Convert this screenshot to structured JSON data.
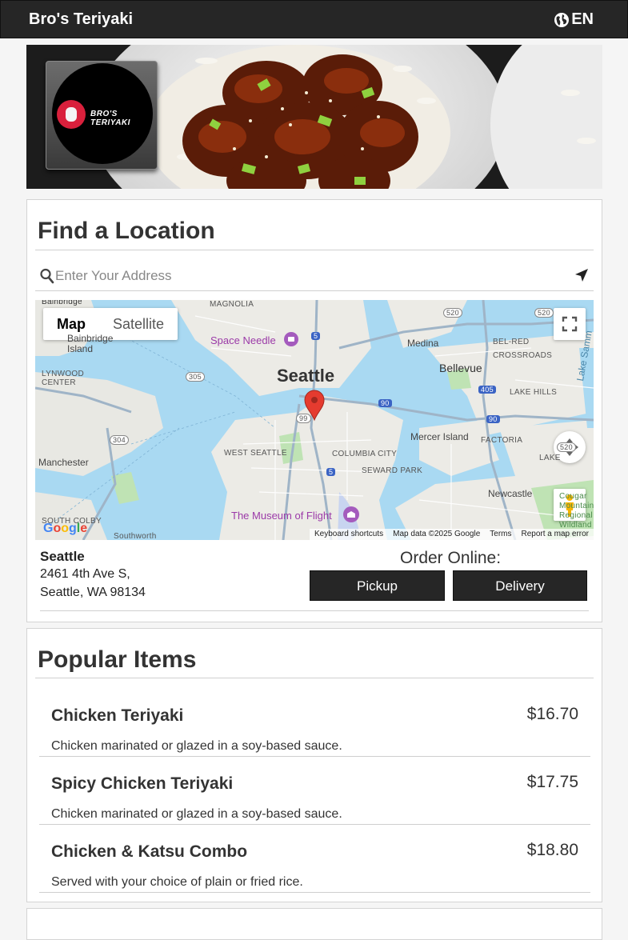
{
  "header": {
    "brand": "Bro's Teriyaki",
    "language": "EN",
    "globe_icon": "globe-icon"
  },
  "hero": {
    "logo_text": "BRO'S TERIYAKI"
  },
  "location": {
    "title": "Find a Location",
    "search_placeholder": "Enter Your Address",
    "map": {
      "toggle_map": "Map",
      "toggle_satellite": "Satellite",
      "labels": {
        "bainbridge": "Bainbridge",
        "bainbridge_island": "Bainbridge\nIsland",
        "magnolia": "MAGNOLIA",
        "space_needle": "Space Needle",
        "seattle": "Seattle",
        "medina": "Medina",
        "bellevue": "Bellevue",
        "bel_red": "BEL-RED",
        "crossroads": "CROSSROADS",
        "lake_hills": "LAKE HILLS",
        "lynwood_center": "LYNWOOD\nCENTER",
        "mercer_island": "Mercer Island",
        "factoria": "FACTORIA",
        "manchester": "Manchester",
        "west_seattle": "WEST SEATTLE",
        "columbia_city": "COLUMBIA CITY",
        "seward_park": "SEWARD PARK",
        "newcastle": "Newcastle",
        "museum_of_flight": "The Museum of Flight",
        "south_colby": "SOUTH COLBY",
        "southworth": "Southworth",
        "lake_sammamish": "Lake Samm",
        "lakemont": "LAKE",
        "cougar": "Cougar\nMountain\nRegional\nWildland Park",
        "hwy_520a": "520",
        "hwy_520b": "520",
        "hwy_520c": "520",
        "hwy_5a": "5",
        "hwy_5b": "5",
        "hwy_90a": "90",
        "hwy_90b": "90",
        "hwy_99": "99",
        "hwy_305": "305",
        "hwy_304": "304",
        "hwy_405": "405"
      },
      "google": "Google",
      "footer": [
        "Keyboard shortcuts",
        "Map data ©2025 Google",
        "Terms",
        "Report a map error"
      ]
    },
    "store": {
      "name": "Seattle",
      "address_line1": "2461 4th Ave S,",
      "address_line2": "Seattle, WA 98134"
    },
    "order_label": "Order Online:",
    "pickup_label": "Pickup",
    "delivery_label": "Delivery"
  },
  "popular": {
    "title": "Popular Items",
    "items": [
      {
        "name": "Chicken Teriyaki",
        "price": "$16.70",
        "description": "Chicken marinated or glazed in a soy-based sauce."
      },
      {
        "name": "Spicy Chicken Teriyaki",
        "price": "$17.75",
        "description": "Chicken marinated or glazed in a soy-based sauce."
      },
      {
        "name": "Chicken & Katsu Combo",
        "price": "$18.80",
        "description": "Served with your choice of plain or fried rice."
      }
    ]
  }
}
